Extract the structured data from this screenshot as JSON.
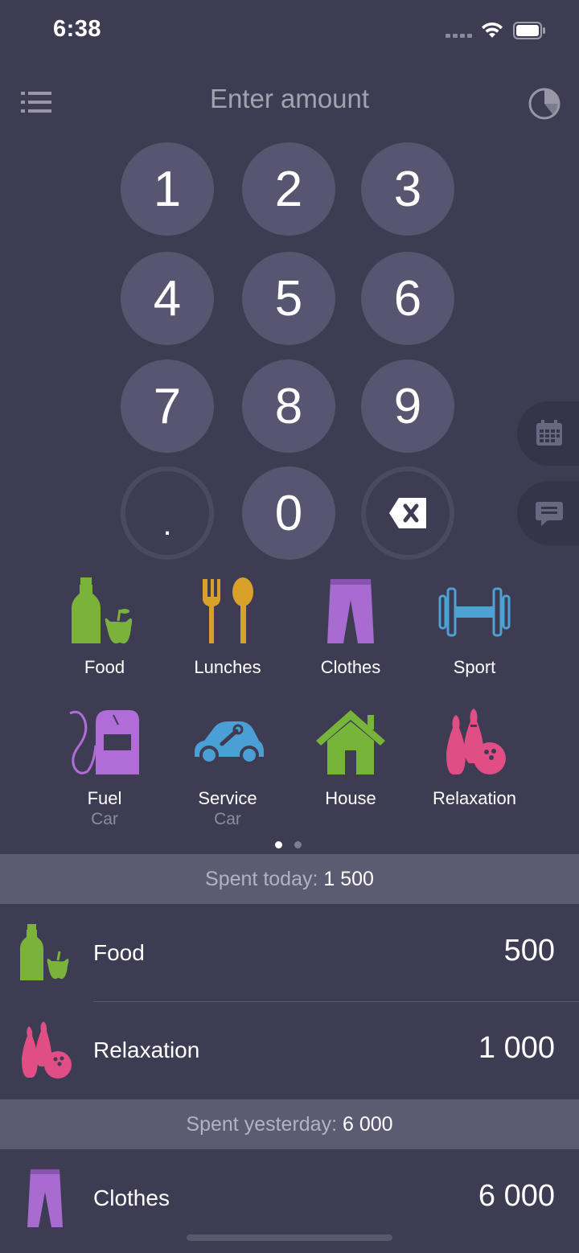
{
  "status_bar": {
    "time": "6:38"
  },
  "header": {
    "title": "Enter amount"
  },
  "keypad": {
    "keys": [
      "1",
      "2",
      "3",
      "4",
      "5",
      "6",
      "7",
      "8",
      "9",
      ".",
      "0"
    ]
  },
  "categories": [
    {
      "label": "Food",
      "sub": "",
      "icon": "food-icon"
    },
    {
      "label": "Lunches",
      "sub": "",
      "icon": "lunches-icon"
    },
    {
      "label": "Clothes",
      "sub": "",
      "icon": "clothes-icon"
    },
    {
      "label": "Sport",
      "sub": "",
      "icon": "sport-icon"
    },
    {
      "label": "Fuel",
      "sub": "Car",
      "icon": "fuel-icon"
    },
    {
      "label": "Service",
      "sub": "Car",
      "icon": "service-icon"
    },
    {
      "label": "House",
      "sub": "",
      "icon": "house-icon"
    },
    {
      "label": "Relaxation",
      "sub": "",
      "icon": "relaxation-icon"
    }
  ],
  "today": {
    "label": "Spent today:",
    "total": "1 500",
    "items": [
      {
        "name": "Food",
        "amount": "500"
      },
      {
        "name": "Relaxation",
        "amount": "1 000"
      }
    ]
  },
  "yesterday": {
    "label": "Spent yesterday:",
    "total": "6 000",
    "items": [
      {
        "name": "Clothes",
        "amount": "6 000"
      }
    ]
  },
  "colors": {
    "background": "#3e3c52",
    "key": "#57556f",
    "food": "#7bb23a",
    "lunches": "#d9a12a",
    "clothes": "#a86cd0",
    "sport": "#4ba2d3",
    "fuel": "#b06dd8",
    "service": "#4a9fd4",
    "house": "#76b43a",
    "relaxation": "#e04e85"
  }
}
